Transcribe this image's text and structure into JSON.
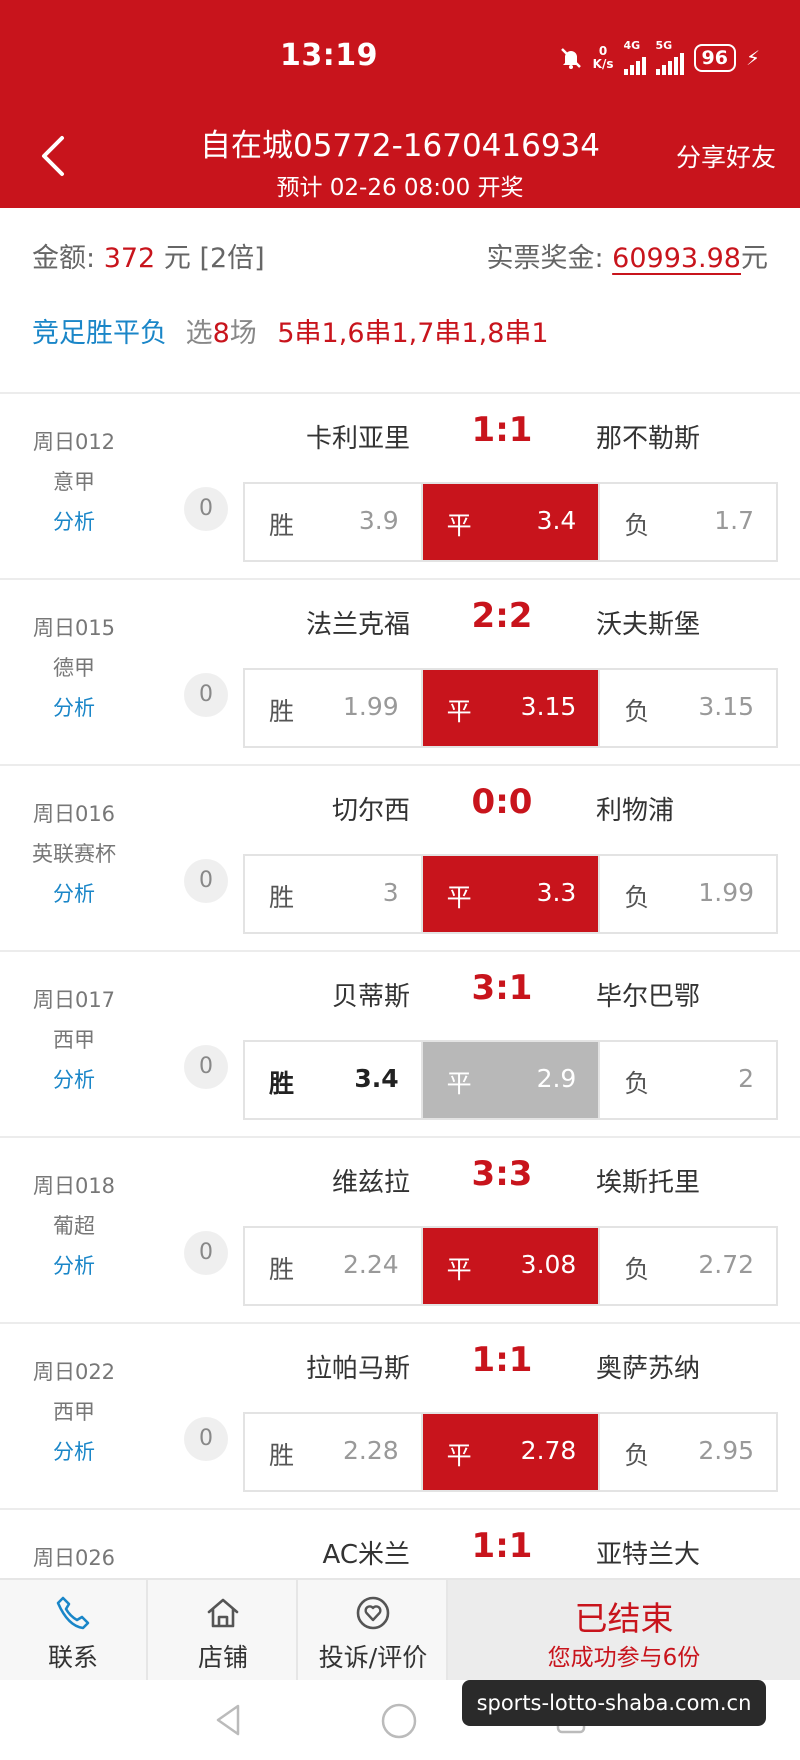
{
  "status": {
    "time": "13:19",
    "net_speed_value": "0",
    "net_speed_unit": "K/s",
    "net1": "4G",
    "net2": "5G",
    "battery": "96"
  },
  "nav": {
    "title": "自在城05772-1670416934",
    "subtitle": "预计 02-26 08:00 开奖",
    "share": "分享好友"
  },
  "summary": {
    "amount_label": "金额:",
    "amount_value": "372",
    "amount_unit": "元",
    "multiplier": "[2倍]",
    "prize_label": "实票奖金:",
    "prize_value": "60993.98",
    "prize_unit": "元",
    "game_type": "竞足胜平负",
    "select_prefix": "选",
    "select_count": "8",
    "select_suffix": "场",
    "combos": "5串1,6串1,7串1,8串1"
  },
  "matches": [
    {
      "week": "周日012",
      "league": "意甲",
      "analysis": "分析",
      "home": "卡利亚里",
      "score": "1:1",
      "away": "那不勒斯",
      "count": "0",
      "odds": [
        {
          "label": "胜",
          "value": "3.9"
        },
        {
          "label": "平",
          "value": "3.4"
        },
        {
          "label": "负",
          "value": "1.7"
        }
      ],
      "selected": "平"
    },
    {
      "week": "周日015",
      "league": "德甲",
      "analysis": "分析",
      "home": "法兰克福",
      "score": "2:2",
      "away": "沃夫斯堡",
      "count": "0",
      "odds": [
        {
          "label": "胜",
          "value": "1.99"
        },
        {
          "label": "平",
          "value": "3.15"
        },
        {
          "label": "负",
          "value": "3.15"
        }
      ],
      "selected": "平"
    },
    {
      "week": "周日016",
      "league": "英联赛杯",
      "analysis": "分析",
      "home": "切尔西",
      "score": "0:0",
      "away": "利物浦",
      "count": "0",
      "odds": [
        {
          "label": "胜",
          "value": "3"
        },
        {
          "label": "平",
          "value": "3.3"
        },
        {
          "label": "负",
          "value": "1.99"
        }
      ],
      "selected": "平"
    },
    {
      "week": "周日017",
      "league": "西甲",
      "analysis": "分析",
      "home": "贝蒂斯",
      "score": "3:1",
      "away": "毕尔巴鄂",
      "count": "0",
      "odds": [
        {
          "label": "胜",
          "value": "3.4"
        },
        {
          "label": "平",
          "value": "2.9"
        },
        {
          "label": "负",
          "value": "2"
        }
      ],
      "selected": "平",
      "selected_missed": true,
      "result": "胜"
    },
    {
      "week": "周日018",
      "league": "葡超",
      "analysis": "分析",
      "home": "维兹拉",
      "score": "3:3",
      "away": "埃斯托里",
      "count": "0",
      "odds": [
        {
          "label": "胜",
          "value": "2.24"
        },
        {
          "label": "平",
          "value": "3.08"
        },
        {
          "label": "负",
          "value": "2.72"
        }
      ],
      "selected": "平"
    },
    {
      "week": "周日022",
      "league": "西甲",
      "analysis": "分析",
      "home": "拉帕马斯",
      "score": "1:1",
      "away": "奥萨苏纳",
      "count": "0",
      "odds": [
        {
          "label": "胜",
          "value": "2.28"
        },
        {
          "label": "平",
          "value": "2.78"
        },
        {
          "label": "负",
          "value": "2.95"
        }
      ],
      "selected": "平"
    },
    {
      "week": "周日026",
      "league": "",
      "analysis": "",
      "home": "AC米兰",
      "score": "1:1",
      "away": "亚特兰大",
      "count": "",
      "odds": [],
      "selected": ""
    }
  ],
  "bottom": {
    "contact": "联系",
    "store": "店铺",
    "complaint": "投诉/评价",
    "ended_title": "已结束",
    "ended_sub": "您成功参与6份"
  },
  "watermark": "sports-lotto-shaba.com.cn",
  "colors": {
    "primary_red": "#c8141c",
    "link_blue": "#1a86c8",
    "missed_gray": "#b8b8b8"
  },
  "icons": {
    "back": "chevron-left-icon",
    "contact": "phone-icon",
    "store": "house-icon",
    "complaint": "heart-circle-icon"
  }
}
